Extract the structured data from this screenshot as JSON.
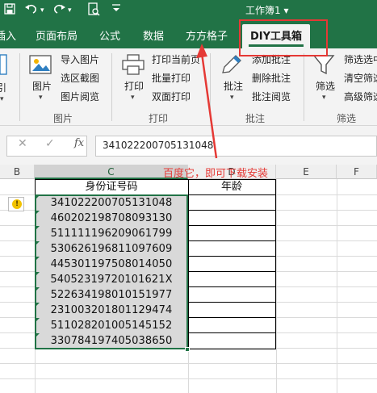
{
  "titlebar": {
    "title": "工作簿1 ▾",
    "icons": [
      "save-icon",
      "undo-icon",
      "redo-icon",
      "preview-icon",
      "customize-icon"
    ]
  },
  "tabs": [
    "插入",
    "页面布局",
    "公式",
    "数据",
    "方方格子",
    "DIY工具箱"
  ],
  "ribbon": {
    "group_picture": {
      "label": "图片",
      "big_button": "图片",
      "items": [
        "导入图片",
        "选区截图",
        "图片阅览"
      ]
    },
    "group_print": {
      "label": "打印",
      "big_button": "打印",
      "items": [
        "打印当前页",
        "批量打印",
        "双面打印"
      ]
    },
    "group_comment": {
      "label": "批注",
      "big_button": "批注",
      "items": [
        "添加批注",
        "删除批注",
        "批注阅览"
      ]
    },
    "group_filter": {
      "label": "筛选",
      "big_button": "筛选",
      "items": [
        "筛选选中",
        "清空筛选",
        "高级筛选"
      ]
    },
    "left_cut": {
      "top": "示",
      "bottom": "引"
    }
  },
  "formula_bar": {
    "cancel": "✕",
    "confirm": "✓",
    "fx": "fx",
    "value": "341022200705131048"
  },
  "sheet": {
    "columns": [
      "B",
      "C",
      "D",
      "E",
      "F"
    ],
    "header_id": "身份证号码",
    "header_age": "年龄",
    "ids": [
      "341022200705131048",
      "460202198708093130",
      "511111196209061799",
      "530626196811097609",
      "445301197508014050",
      "54052319720101621X",
      "522634198010151977",
      "231003201801129474",
      "511028201005145152",
      "330784197405038650"
    ]
  },
  "annotation": {
    "text": "百度它，即可下载安装",
    "color": "#e53935"
  },
  "colors": {
    "excel_green": "#217346",
    "selection_fill": "#d9d9d9"
  }
}
